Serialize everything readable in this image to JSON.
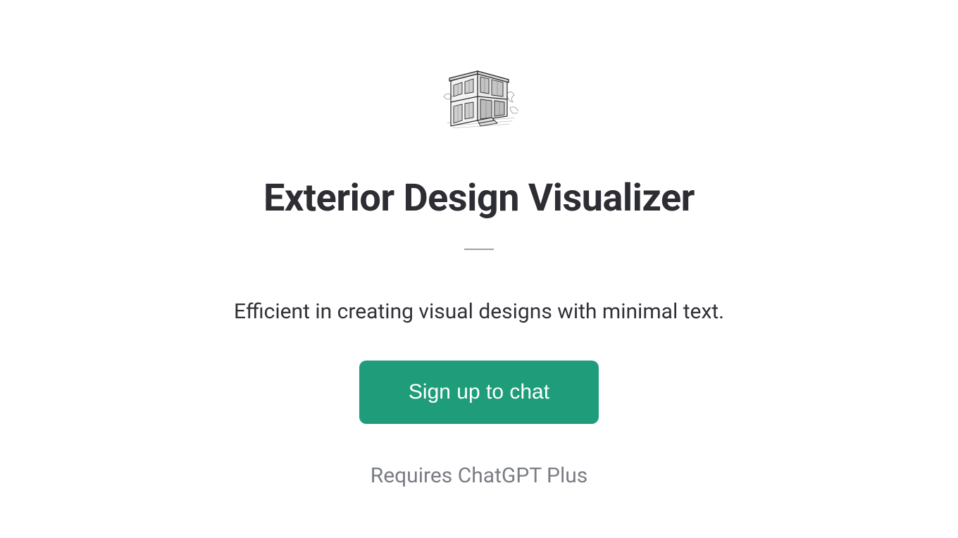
{
  "hero": {
    "title": "Exterior Design Visualizer",
    "description": "Efficient in creating visual designs with minimal text.",
    "cta_label": "Sign up to chat",
    "requires_label": "Requires ChatGPT Plus",
    "icon_name": "house-sketch-icon"
  },
  "colors": {
    "accent": "#1f9d7a",
    "title": "#2d2d34",
    "body": "#2f3136",
    "muted": "#7a7d85"
  }
}
